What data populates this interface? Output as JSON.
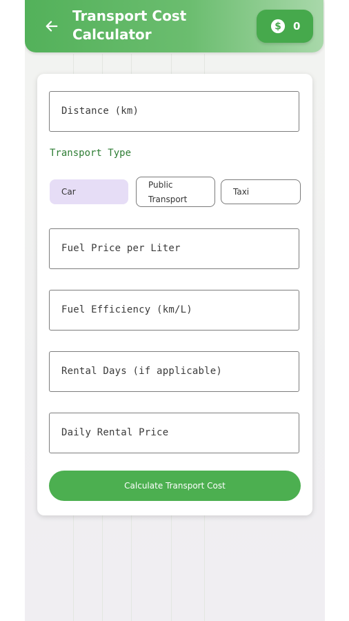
{
  "header": {
    "title_line1": "Transport Cost",
    "title_line2": "Calculator",
    "coins": "0",
    "back_icon": "arrow-left-icon",
    "coin_icon": "dollar-coin-icon"
  },
  "form": {
    "distance_placeholder": "Distance (km)",
    "transport_type_label": "Transport Type",
    "transport_options": [
      "Car",
      "Public",
      "Transport",
      "Taxi"
    ],
    "selected_transport": "Car",
    "fuel_price_placeholder": "Fuel Price per Liter",
    "fuel_efficiency_placeholder": "Fuel Efficiency (km/L)",
    "rental_days_placeholder": "Rental Days (if applicable)",
    "daily_rental_placeholder": "Daily Rental Price",
    "calculate_label": "Calculate Transport Cost"
  },
  "colors": {
    "primary": "#4caf50",
    "selected_chip": "#e6ddf6",
    "label_green": "#2e7d34"
  }
}
